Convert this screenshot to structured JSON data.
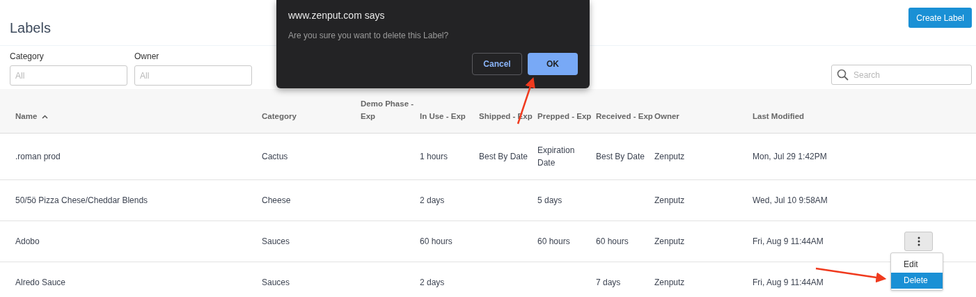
{
  "page": {
    "title": "Labels",
    "create_button": "Create Label"
  },
  "filters": [
    {
      "label": "Category",
      "placeholder": "All"
    },
    {
      "label": "Owner",
      "placeholder": "All"
    }
  ],
  "search": {
    "placeholder": "Search"
  },
  "table": {
    "columns": [
      {
        "label": "Name",
        "sorted": true
      },
      {
        "label": "Category",
        "sorted": false
      },
      {
        "label": "Demo Phase - Exp",
        "sorted": false
      },
      {
        "label": "In Use - Exp",
        "sorted": false
      },
      {
        "label": "Shipped - Exp",
        "sorted": false
      },
      {
        "label": "Prepped - Exp",
        "sorted": false
      },
      {
        "label": "Received - Exp",
        "sorted": false
      },
      {
        "label": "Owner",
        "sorted": false
      },
      {
        "label": "Last Modified",
        "sorted": false
      }
    ],
    "rows": [
      {
        "cells": [
          ".roman prod",
          "Cactus",
          "",
          "1 hours",
          "Best By Date",
          "Expiration Date",
          "Best By Date",
          "Zenputz",
          "Mon, Jul 29 1:42PM"
        ],
        "menu_button": false
      },
      {
        "cells": [
          "50/5ö Pizza Chese/Cheddar Blends",
          "Cheese",
          "",
          "2 days",
          "",
          "5 days",
          "",
          "Zenputz",
          "Wed, Jul 10 9:58AM"
        ],
        "menu_button": false
      },
      {
        "cells": [
          "Adobo",
          "Sauces",
          "",
          "60 hours",
          "",
          "60 hours",
          "60 hours",
          "Zenputz",
          "Fri, Aug 9 11:44AM"
        ],
        "menu_button": true
      },
      {
        "cells": [
          "Alredo Sauce",
          "Sauces",
          "",
          "2 days",
          "",
          "",
          "7 days",
          "Zenputz",
          "Fri, Aug 9 11:44AM"
        ],
        "menu_button": false
      }
    ]
  },
  "row_menu": {
    "items": [
      {
        "label": "Edit",
        "selected": false
      },
      {
        "label": "Delete",
        "selected": true
      }
    ]
  },
  "dialog": {
    "title": "www.zenput.com says",
    "message": "Are you sure you want to delete this Label?",
    "buttons": [
      {
        "label": "Cancel",
        "kind": "secondary"
      },
      {
        "label": "OK",
        "kind": "primary"
      }
    ]
  }
}
